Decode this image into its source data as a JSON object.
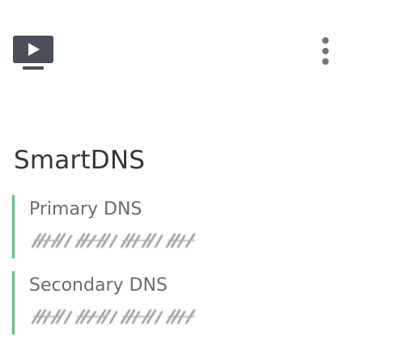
{
  "header": {
    "tv_icon": "tv-play-icon",
    "more_icon": "more-vertical-icon"
  },
  "section": {
    "title": "SmartDNS"
  },
  "dns": {
    "primary": {
      "label": "Primary DNS"
    },
    "secondary": {
      "label": "Secondary DNS"
    }
  },
  "colors": {
    "accent": "#5fc17f",
    "icon": "#4a4f5a",
    "text": "#35353a",
    "label": "#6b6b70"
  }
}
